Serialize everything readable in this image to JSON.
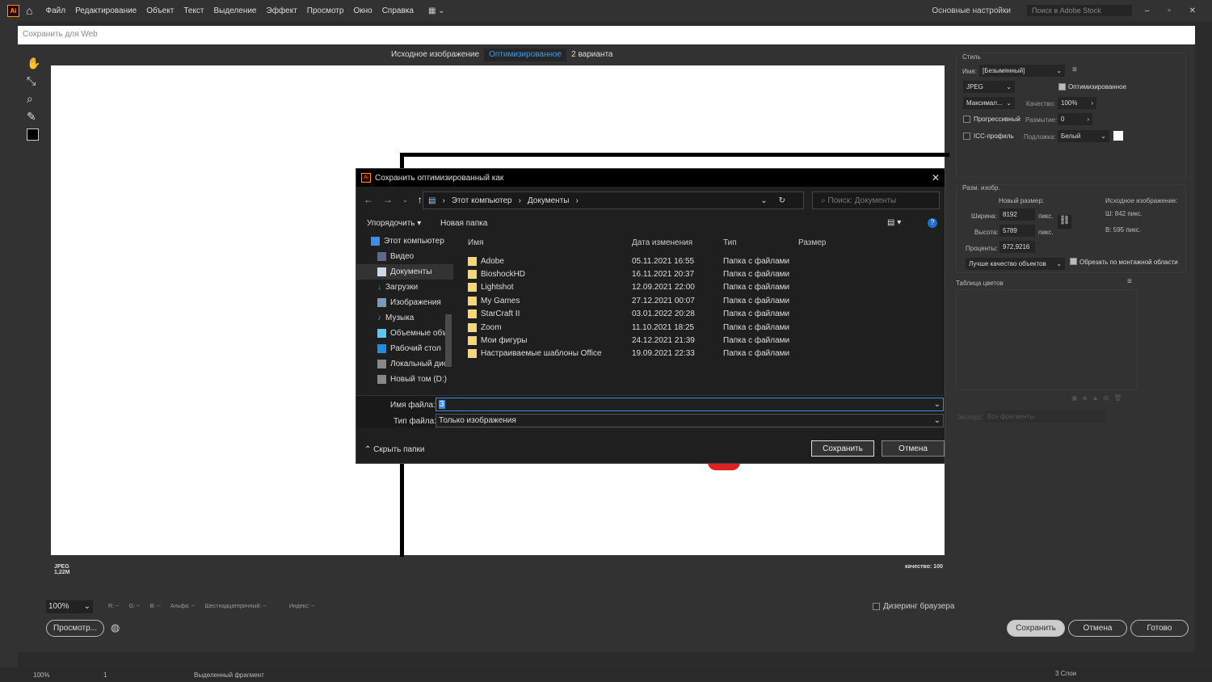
{
  "app": {
    "logo": "Ai",
    "menu": [
      "Файл",
      "Редактирование",
      "Объект",
      "Текст",
      "Выделение",
      "Эффект",
      "Просмотр",
      "Окно",
      "Справка"
    ],
    "workspace": "Основные настройки",
    "stock_search_placeholder": "Поиск в Adobe Stock"
  },
  "sfw": {
    "title": "Сохранить для Web",
    "tabs": [
      "Исходное изображение",
      "Оптимизированное",
      "2 варианта"
    ],
    "active_tab": 1,
    "info_format": "JPEG",
    "info_size": "1,22M",
    "info_quality": "качество: 100",
    "zoom": "100%",
    "readouts": [
      "R: --",
      "G: --",
      "B: --",
      "Альфа: --",
      "Шестнадцатеричный: --",
      "Индекс: --"
    ],
    "preview_btn": "Просмотр...",
    "dither_label": "Дизеринг браузера",
    "save": "Сохранить",
    "cancel": "Отмена",
    "done": "Готово"
  },
  "panel": {
    "style_title": "Стиль",
    "name_label": "Имя:",
    "name_value": "[Безымянный]",
    "format": "JPEG",
    "optimized_label": "Оптимизированное",
    "optimized": true,
    "quality_preset": "Максимал...",
    "quality_label": "Качество:",
    "quality_value": "100%",
    "progressive_label": "Прогрессивный",
    "progressive": false,
    "blur_label": "Размытие:",
    "blur_value": "0",
    "icc_label": "ICC-профиль",
    "icc": false,
    "matte_label": "Подложка:",
    "matte_value": "Белый",
    "matte_color": "#ffffff",
    "size_title": "Разм. изобр.",
    "new_size": "Новый размер:",
    "orig_size": "Исходное изображение:",
    "width_label": "Ширина:",
    "width": "8192",
    "height_label": "Высота:",
    "height": "5789",
    "unit": "пикс.",
    "percent_label": "Проценты:",
    "percent": "972,9216",
    "orig_w": "Ш:  842 пикс.",
    "orig_h": "В:   595 пикс.",
    "resample": "Лучше качество объектов",
    "clip_label": "Обрезать по монтажной области",
    "clip": true,
    "color_table": "Таблица цветов",
    "export_label": "Экспорт:",
    "export_value": "Все фрагменты"
  },
  "dialog": {
    "title": "Сохранить оптимизированный как",
    "path": [
      "Этот компьютер",
      "Документы"
    ],
    "search_placeholder": "Поиск: Документы",
    "organize": "Упорядочить",
    "new_folder": "Новая папка",
    "nav": [
      "Этот компьютер",
      "Видео",
      "Документы",
      "Загрузки",
      "Изображения",
      "Музыка",
      "Объемные объ",
      "Рабочий стол",
      "Локальный дис",
      "Новый том (D:)"
    ],
    "columns": [
      "Имя",
      "Дата изменения",
      "Тип",
      "Размер"
    ],
    "files": [
      {
        "name": "Adobe",
        "date": "05.11.2021 16:55",
        "type": "Папка с файлами"
      },
      {
        "name": "BioshockHD",
        "date": "16.11.2021 20:37",
        "type": "Папка с файлами"
      },
      {
        "name": "Lightshot",
        "date": "12.09.2021 22:00",
        "type": "Папка с файлами"
      },
      {
        "name": "My Games",
        "date": "27.12.2021 00:07",
        "type": "Папка с файлами"
      },
      {
        "name": "StarCraft II",
        "date": "03.01.2022 20:28",
        "type": "Папка с файлами"
      },
      {
        "name": "Zoom",
        "date": "11.10.2021 18:25",
        "type": "Папка с файлами"
      },
      {
        "name": "Мои фигуры",
        "date": "24.12.2021 21:39",
        "type": "Папка с файлами"
      },
      {
        "name": "Настраиваемые шаблоны Office",
        "date": "19.09.2021 22:33",
        "type": "Папка с файлами"
      }
    ],
    "filename_label": "Имя файла:",
    "filename": "3",
    "filetype_label": "Тип файла:",
    "filetype": "Только изображения",
    "hide_folders": "Скрыть папки",
    "save": "Сохранить",
    "cancel": "Отмена"
  },
  "statusbar": {
    "zoom": "100%",
    "artboard": "1",
    "selection": "Выделенный фрагмент",
    "layers": "3 Слои"
  }
}
